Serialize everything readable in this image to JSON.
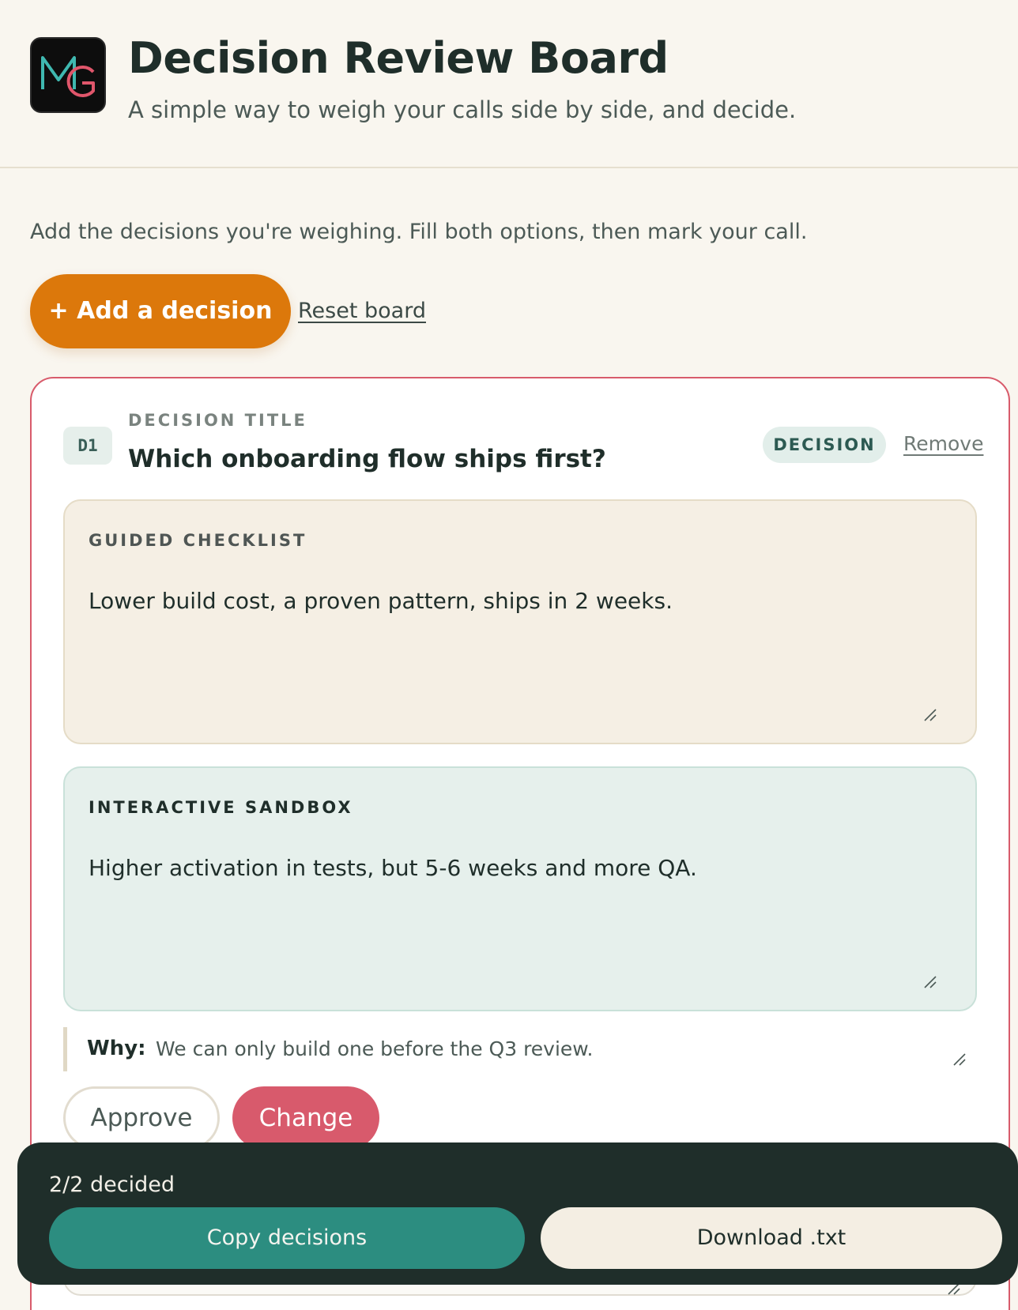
{
  "header": {
    "logo_text": "MG",
    "title": "Decision Review Board",
    "subtitle": "A simple way to weigh your calls side by side, and decide."
  },
  "intro": "Add the decisions you're weighing. Fill both options, then mark your call.",
  "actions": {
    "add_label": "+ Add a decision",
    "reset_label": "Reset board"
  },
  "decision": {
    "id": "D1",
    "title_label": "DECISION TITLE",
    "title": "Which onboarding flow ships first?",
    "status": "DECISION",
    "remove_label": "Remove",
    "option_a": {
      "label": "GUIDED CHECKLIST",
      "text": "Lower build cost, a proven pattern, ships in 2 weeks."
    },
    "option_b": {
      "label": "INTERACTIVE SANDBOX",
      "text": "Higher activation in tests, but 5-6 weeks and more QA."
    },
    "why_label": "Why:",
    "why_text": "We can only build one before the Q3 review.",
    "approve_label": "Approve",
    "change_label": "Change"
  },
  "footer": {
    "decided": "2/2 decided",
    "copy_label": "Copy decisions",
    "download_label": "Download .txt"
  },
  "colors": {
    "accent_orange": "#dc780b",
    "accent_red": "#d85a6c",
    "accent_teal": "#2c8d80",
    "dark": "#1f2e2a"
  }
}
